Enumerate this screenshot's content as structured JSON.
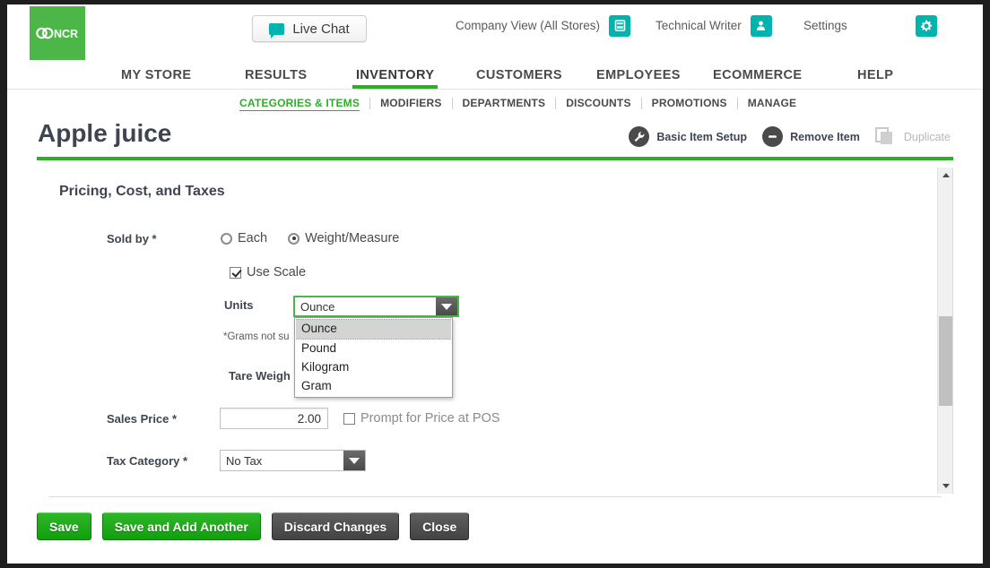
{
  "header": {
    "logo_alt": "NCR",
    "live_chat": "Live Chat",
    "company_view": "Company View (All Stores)",
    "user": "Technical Writer",
    "settings": "Settings"
  },
  "mainnav": [
    {
      "label": "MY STORE",
      "active": false
    },
    {
      "label": "RESULTS",
      "active": false
    },
    {
      "label": "INVENTORY",
      "active": true
    },
    {
      "label": "CUSTOMERS",
      "active": false
    },
    {
      "label": "EMPLOYEES",
      "active": false
    },
    {
      "label": "ECOMMERCE",
      "active": false
    },
    {
      "label": "HELP",
      "active": false
    }
  ],
  "subnav": [
    {
      "label": "CATEGORIES & ITEMS",
      "active": true
    },
    {
      "label": "MODIFIERS",
      "active": false
    },
    {
      "label": "DEPARTMENTS",
      "active": false
    },
    {
      "label": "DISCOUNTS",
      "active": false
    },
    {
      "label": "PROMOTIONS",
      "active": false
    },
    {
      "label": "MANAGE",
      "active": false
    }
  ],
  "title": {
    "text": "Apple juice",
    "actions": [
      {
        "label": "Basic Item Setup",
        "icon": "wrench-icon",
        "disabled": false
      },
      {
        "label": "Remove Item",
        "icon": "minus-circle-icon",
        "disabled": false
      },
      {
        "label": "Duplicate",
        "icon": "duplicate-icon",
        "disabled": true
      }
    ]
  },
  "form": {
    "section_title": "Pricing, Cost, and Taxes",
    "sold_by": {
      "label": "Sold by *",
      "options": [
        {
          "label": "Each",
          "checked": false
        },
        {
          "label": "Weight/Measure",
          "checked": true
        }
      ]
    },
    "use_scale": {
      "label": "Use Scale",
      "checked": true
    },
    "units": {
      "label": "Units",
      "value": "Ounce",
      "open": true,
      "options": [
        "Ounce",
        "Pound",
        "Kilogram",
        "Gram"
      ],
      "selected_index": 0
    },
    "grams_note": "*Grams not su",
    "tare_weight": {
      "label": "Tare Weigh"
    },
    "sales_price": {
      "label": "Sales Price *",
      "value": "2.00"
    },
    "prompt_price": {
      "label": "Prompt for Price at POS",
      "checked": false
    },
    "tax_category": {
      "label": "Tax Category *",
      "value": "No Tax"
    }
  },
  "buttons": [
    {
      "label": "Save",
      "style": "green"
    },
    {
      "label": "Save and Add Another",
      "style": "green"
    },
    {
      "label": "Discard Changes",
      "style": "grey"
    },
    {
      "label": "Close",
      "style": "grey"
    }
  ],
  "colors": {
    "brand_green": "#4CB748",
    "accent_green": "#2DAE27",
    "teal": "#00B3AE",
    "dark_grey": "#4a4a4a"
  }
}
